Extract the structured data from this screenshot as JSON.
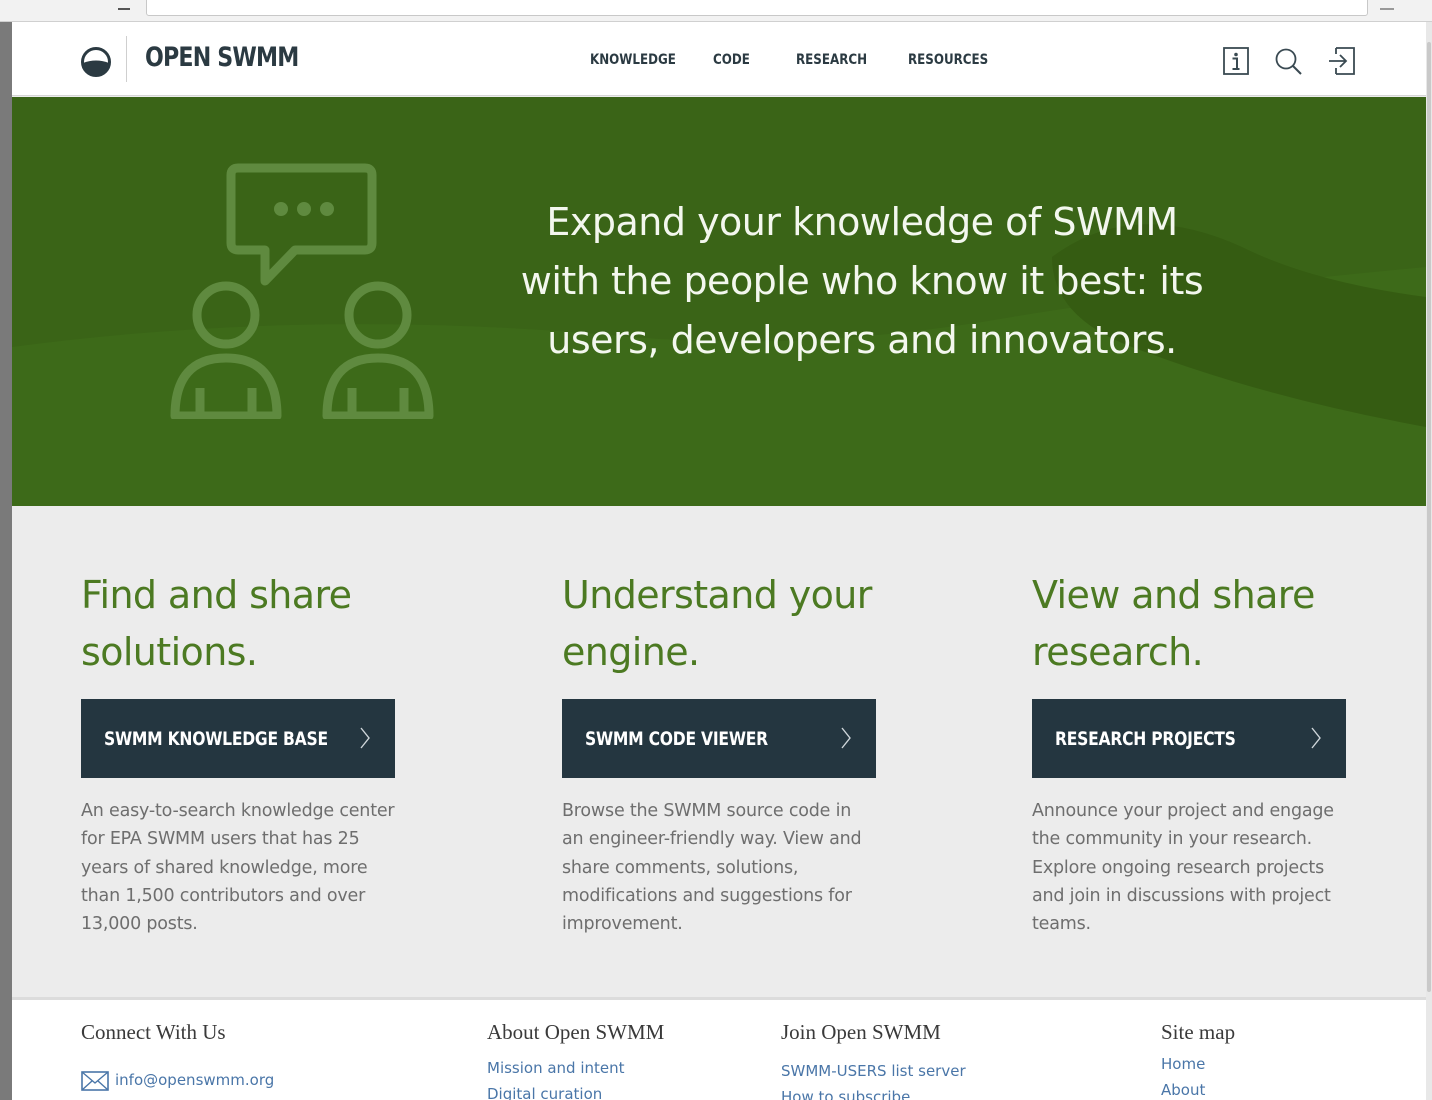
{
  "brand": {
    "name": "OPEN SWMM"
  },
  "nav": {
    "items": [
      "KNOWLEDGE",
      "CODE",
      "RESEARCH",
      "RESOURCES"
    ]
  },
  "header_icons": [
    "info-icon",
    "search-icon",
    "sign-in-icon"
  ],
  "hero": {
    "lines": [
      "Expand your knowledge of SWMM",
      "with the people who know it best: its",
      "users, developers and innovators."
    ]
  },
  "features": [
    {
      "title_lines": [
        "Find and share",
        "solutions."
      ],
      "button": "SWMM KNOWLEDGE BASE",
      "desc_lines": [
        "An easy-to-search knowledge center",
        "for EPA SWMM users that has 25",
        "years of shared knowledge, more",
        "than 1,500 contributors and over",
        "13,000 posts."
      ]
    },
    {
      "title_lines": [
        "Understand your",
        "engine."
      ],
      "button": "SWMM CODE VIEWER",
      "desc_lines": [
        "Browse the SWMM source code in",
        "an engineer-friendly way. View and",
        "share comments, solutions,",
        "modifications and suggestions for",
        "improvement."
      ]
    },
    {
      "title_lines": [
        "View and share",
        "research."
      ],
      "button": "RESEARCH PROJECTS",
      "desc_lines": [
        "Announce your project and engage",
        "the community in your research.",
        "Explore ongoing research projects",
        "and join in discussions with project",
        "teams."
      ]
    }
  ],
  "footer": {
    "connect": {
      "title": "Connect With Us",
      "email": "info@openswmm.org"
    },
    "about": {
      "title": "About Open SWMM",
      "links": [
        "Mission and intent",
        "Digital curation"
      ]
    },
    "join": {
      "title": "Join Open SWMM",
      "links": [
        "SWMM-USERS list server",
        "How to subscribe"
      ]
    },
    "sitemap": {
      "title": "Site map",
      "links": [
        "Home",
        "About"
      ]
    }
  },
  "colors": {
    "hero_green": "#3a6417",
    "heading_green": "#4c7a22",
    "button_dark": "#243640",
    "link_blue": "#4a76a8"
  }
}
